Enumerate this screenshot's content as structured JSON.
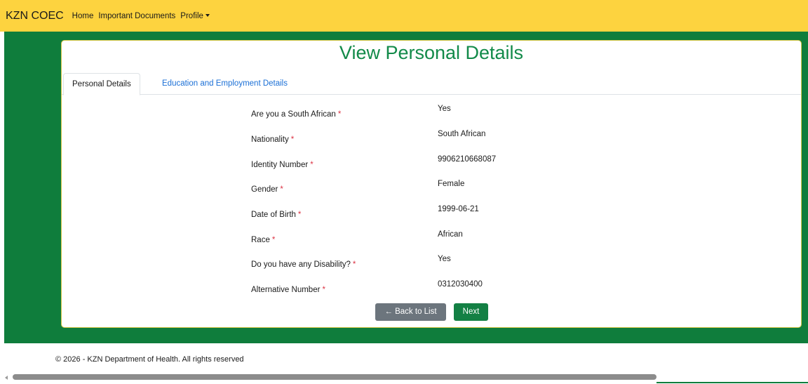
{
  "navbar": {
    "brand": "KZN COEC",
    "links": [
      "Home",
      "Important Documents",
      "Profile"
    ]
  },
  "page": {
    "title": "View Personal Details"
  },
  "tabs": [
    {
      "label": "Personal Details",
      "active": true
    },
    {
      "label": "Education and Employment Details",
      "active": false
    }
  ],
  "fields": [
    {
      "label": "Are you a South African",
      "required": "*",
      "value": "Yes"
    },
    {
      "label": "Nationality",
      "required": "*",
      "value": "South African"
    },
    {
      "label": "Identity Number",
      "required": "*",
      "value": "9906210668087"
    },
    {
      "label": "Gender",
      "required": "*",
      "value": "Female"
    },
    {
      "label": "Date of Birth",
      "required": "*",
      "value": "1999-06-21"
    },
    {
      "label": "Race",
      "required": "*",
      "value": "African"
    },
    {
      "label": "Do you have any Disability?",
      "required": "*",
      "value": "Yes"
    },
    {
      "label": "Alternative Number",
      "required": "*",
      "value": "0312030400"
    }
  ],
  "buttons": {
    "back_label": "← Back to List",
    "next_label": "Next"
  },
  "footer": {
    "text": "© 2026 - KZN Department of Health. All rights reserved"
  },
  "icons": {
    "profile_dropdown": "chevron-down-icon",
    "scroll_left": "arrow-left-icon"
  },
  "colors": {
    "navbar": "#fdd33f",
    "green": "#0f7d3c",
    "title": "#128a49",
    "required": "#dc3545",
    "link": "#1a6fd6",
    "back_button": "#6c757d"
  }
}
